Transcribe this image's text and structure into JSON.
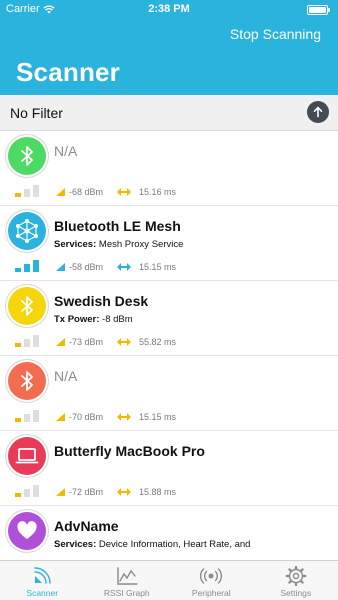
{
  "status_bar": {
    "carrier": "Carrier",
    "time": "2:38 PM"
  },
  "header": {
    "title": "Scanner",
    "stop_label": "Stop Scanning"
  },
  "filter": {
    "label": "No Filter"
  },
  "colors": {
    "accent": "#2ab4dd",
    "signal_weak": "#f5b800",
    "signal_good": "#2ab4dd"
  },
  "devices": [
    {
      "name": "N/A",
      "detail_label": "",
      "detail_value": "",
      "rssi": "-68 dBm",
      "interval": "15.16 ms",
      "avatar_color": "#4cd964",
      "icon": "bluetooth-icon",
      "signal_level": 1
    },
    {
      "name": "Bluetooth LE Mesh",
      "detail_label": "Services:",
      "detail_value": " Mesh Proxy Service",
      "rssi": "-58 dBm",
      "interval": "15.15 ms",
      "avatar_color": "#2ab4dd",
      "icon": "mesh-network-icon",
      "signal_level": 3
    },
    {
      "name": "Swedish Desk",
      "detail_label": "Tx Power:",
      "detail_value": " -8 dBm",
      "rssi": "-73 dBm",
      "interval": "55.82 ms",
      "avatar_color": "#f5d60a",
      "icon": "bluetooth-icon",
      "signal_level": 1
    },
    {
      "name": "N/A",
      "detail_label": "",
      "detail_value": "",
      "rssi": "-70 dBm",
      "interval": "15.15 ms",
      "avatar_color": "#f26d4f",
      "icon": "bluetooth-icon",
      "signal_level": 1
    },
    {
      "name": "Butterfly MacBook Pro",
      "detail_label": "",
      "detail_value": "",
      "rssi": "-72 dBm",
      "interval": "15.88 ms",
      "avatar_color": "#e93a5a",
      "icon": "laptop-icon",
      "signal_level": 1
    },
    {
      "name": "AdvName",
      "detail_label": "Services:",
      "detail_value": " Device Information, Heart Rate, and",
      "rssi": "",
      "interval": "",
      "avatar_color": "#b050d8",
      "icon": "heart-icon",
      "signal_level": 0
    }
  ],
  "tabs": [
    {
      "label": "Scanner",
      "icon": "scanner-icon",
      "active": true
    },
    {
      "label": "RSSI Graph",
      "icon": "graph-icon",
      "active": false
    },
    {
      "label": "Peripheral",
      "icon": "peripheral-icon",
      "active": false
    },
    {
      "label": "Settings",
      "icon": "gear-icon",
      "active": false
    }
  ]
}
